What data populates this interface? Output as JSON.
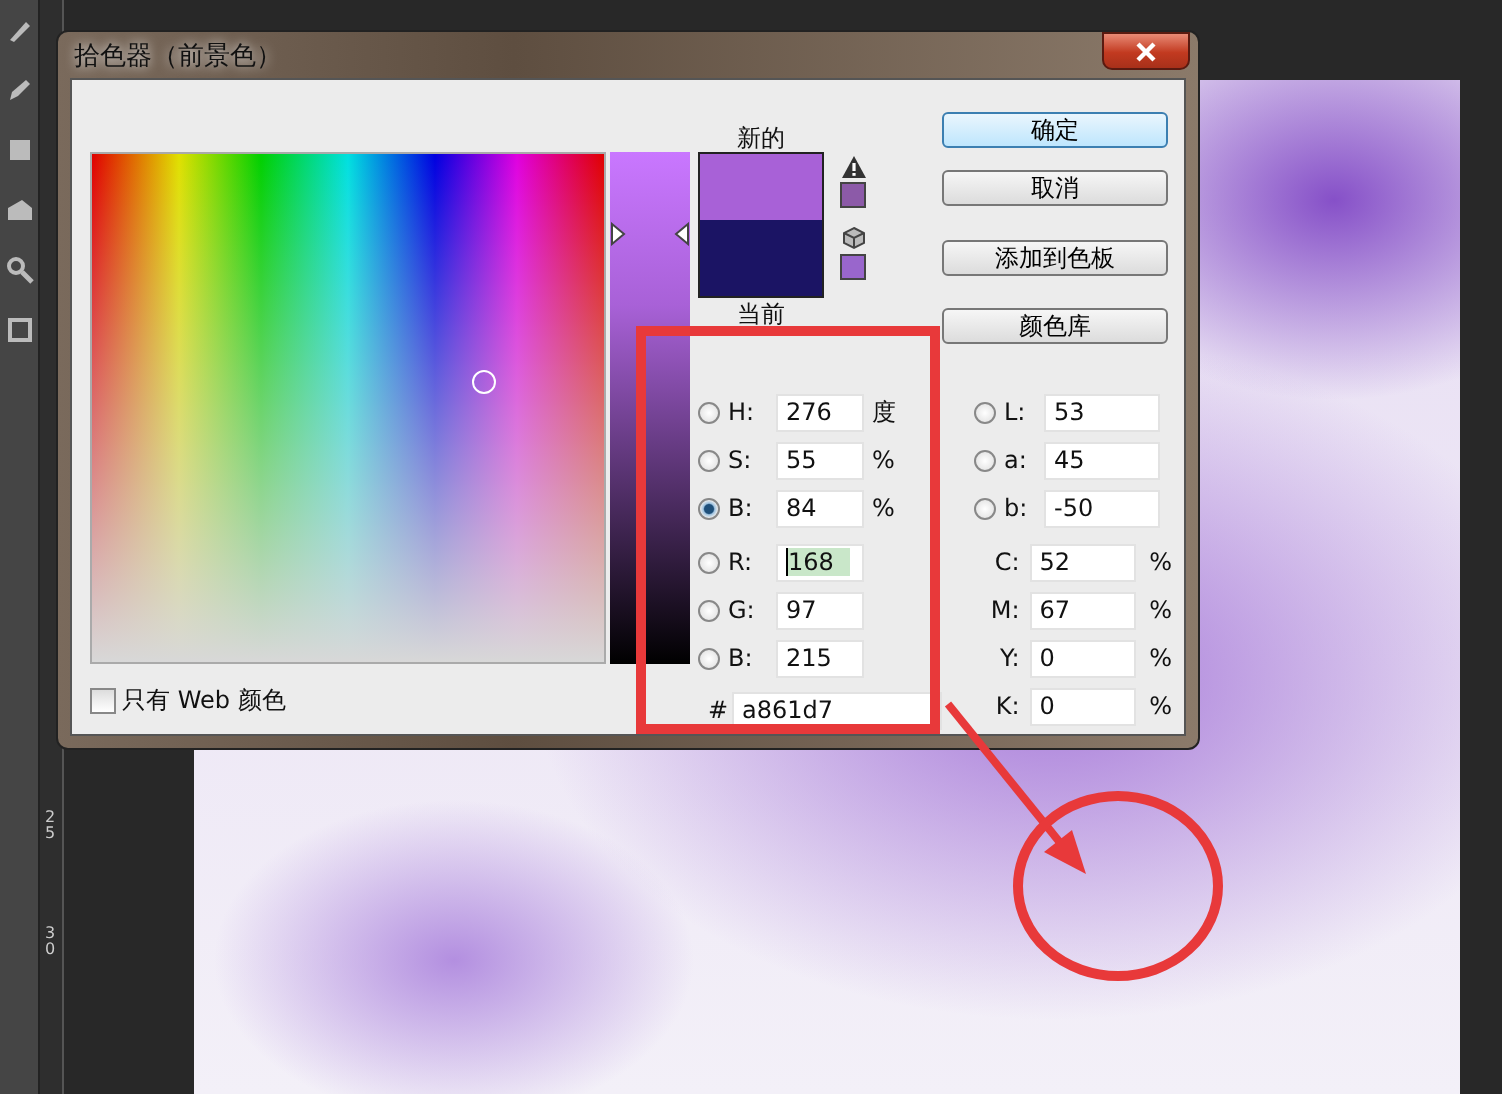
{
  "window": {
    "title": "拾色器（前景色）"
  },
  "ruler_labels": [
    "25",
    "30"
  ],
  "brightness_slider": {
    "level": 0.84
  },
  "web_only": {
    "label": "只有 Web 颜色",
    "checked": false
  },
  "swatches": [
    {
      "label": "新的",
      "color": "#a861d7"
    },
    {
      "label": "当前",
      "color": "#1b1464"
    }
  ],
  "alerts": [
    {
      "kind": "gamut",
      "color": "#8c5aa8"
    },
    {
      "kind": "web",
      "color": "#9966cc"
    }
  ],
  "buttons": [
    {
      "label": "确定",
      "default": true
    },
    {
      "label": "取消",
      "default": false
    },
    {
      "label": "添加到色板",
      "default": false
    },
    {
      "label": "颜色库",
      "default": false
    }
  ],
  "hsb": [
    {
      "label": "H:",
      "value": "276",
      "unit": "度",
      "selected": false
    },
    {
      "label": "S:",
      "value": "55",
      "unit": "%",
      "selected": false
    },
    {
      "label": "B:",
      "value": "84",
      "unit": "%",
      "selected": true
    }
  ],
  "rgb": [
    {
      "label": "R:",
      "value": "168",
      "focused": true,
      "selected": false
    },
    {
      "label": "G:",
      "value": "97",
      "focused": false,
      "selected": false
    },
    {
      "label": "B:",
      "value": "215",
      "focused": false,
      "selected": false
    }
  ],
  "hex": {
    "prefix": "#",
    "value": "a861d7"
  },
  "lab": [
    {
      "label": "L:",
      "value": "53",
      "selected": false
    },
    {
      "label": "a:",
      "value": "45",
      "selected": false
    },
    {
      "label": "b:",
      "value": "-50",
      "selected": false
    }
  ],
  "cmyk": [
    {
      "label": "C:",
      "value": "52",
      "unit": "%"
    },
    {
      "label": "M:",
      "value": "67",
      "unit": "%"
    },
    {
      "label": "Y:",
      "value": "0",
      "unit": "%"
    },
    {
      "label": "K:",
      "value": "0",
      "unit": "%"
    }
  ]
}
